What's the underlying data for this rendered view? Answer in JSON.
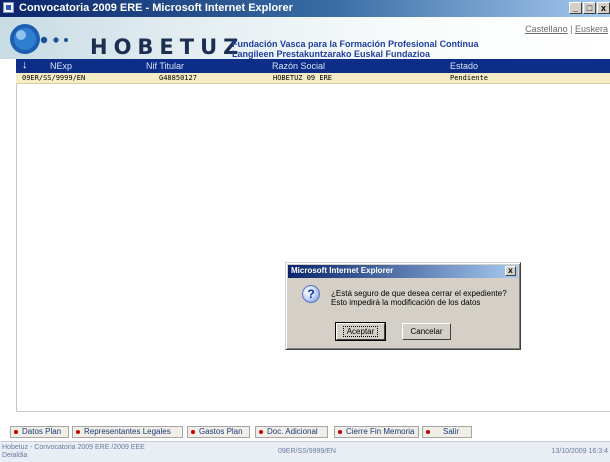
{
  "window": {
    "title": "Convocatoria 2009 ERE - Microsoft Internet Explorer",
    "minimize_label": "_",
    "maximize_label": "□",
    "close_label": "x"
  },
  "header": {
    "logo_text": "HOBETUZ",
    "tagline_es": "Fundación Vasca para la Formación Profesional Continua",
    "tagline_eu": "Langileen Prestakuntzarako Euskal Fundazioa",
    "lang_es": "Castellano",
    "lang_separator": "|",
    "lang_eu": "Euskera"
  },
  "table": {
    "sort_icon": "↓",
    "columns": [
      "NExp",
      "Nif Titular",
      "Razón Social",
      "Estado"
    ],
    "rows": [
      {
        "nexp": "09ER/SS/9999/EN",
        "nif": "G48850127",
        "razon": "HOBETUZ 09 ERE",
        "estado": "Pendiente"
      }
    ]
  },
  "dialog": {
    "title": "Microsoft Internet Explorer",
    "close_label": "x",
    "icon": "question-icon",
    "icon_glyph": "?",
    "message_line1": "¿Está seguro de que desea cerrar el expediente?",
    "message_line2": "Esto impedirá la modificación de los datos",
    "accept_label": "Aceptar",
    "cancel_label": "Cancelar"
  },
  "nav": {
    "items": [
      {
        "label": "Datos Plan"
      },
      {
        "label": "Representantes Legales"
      },
      {
        "label": "Gastos Plan"
      },
      {
        "label": "Doc. Adicional"
      },
      {
        "label": "Cierre Fin Memoria"
      },
      {
        "label": "Salir"
      }
    ]
  },
  "status": {
    "left_line1": "Hobetuz - Convocatoria 2009 ERE /2009 EEE",
    "left_line2": "Deialdia",
    "center": "09ER/SS/9999/EN",
    "right": "13/10/2009 16:3:4"
  },
  "colors": {
    "header_bar": "#0c2e88",
    "row_highlight": "#f3ecc5",
    "nav_dot": "#c40000"
  }
}
